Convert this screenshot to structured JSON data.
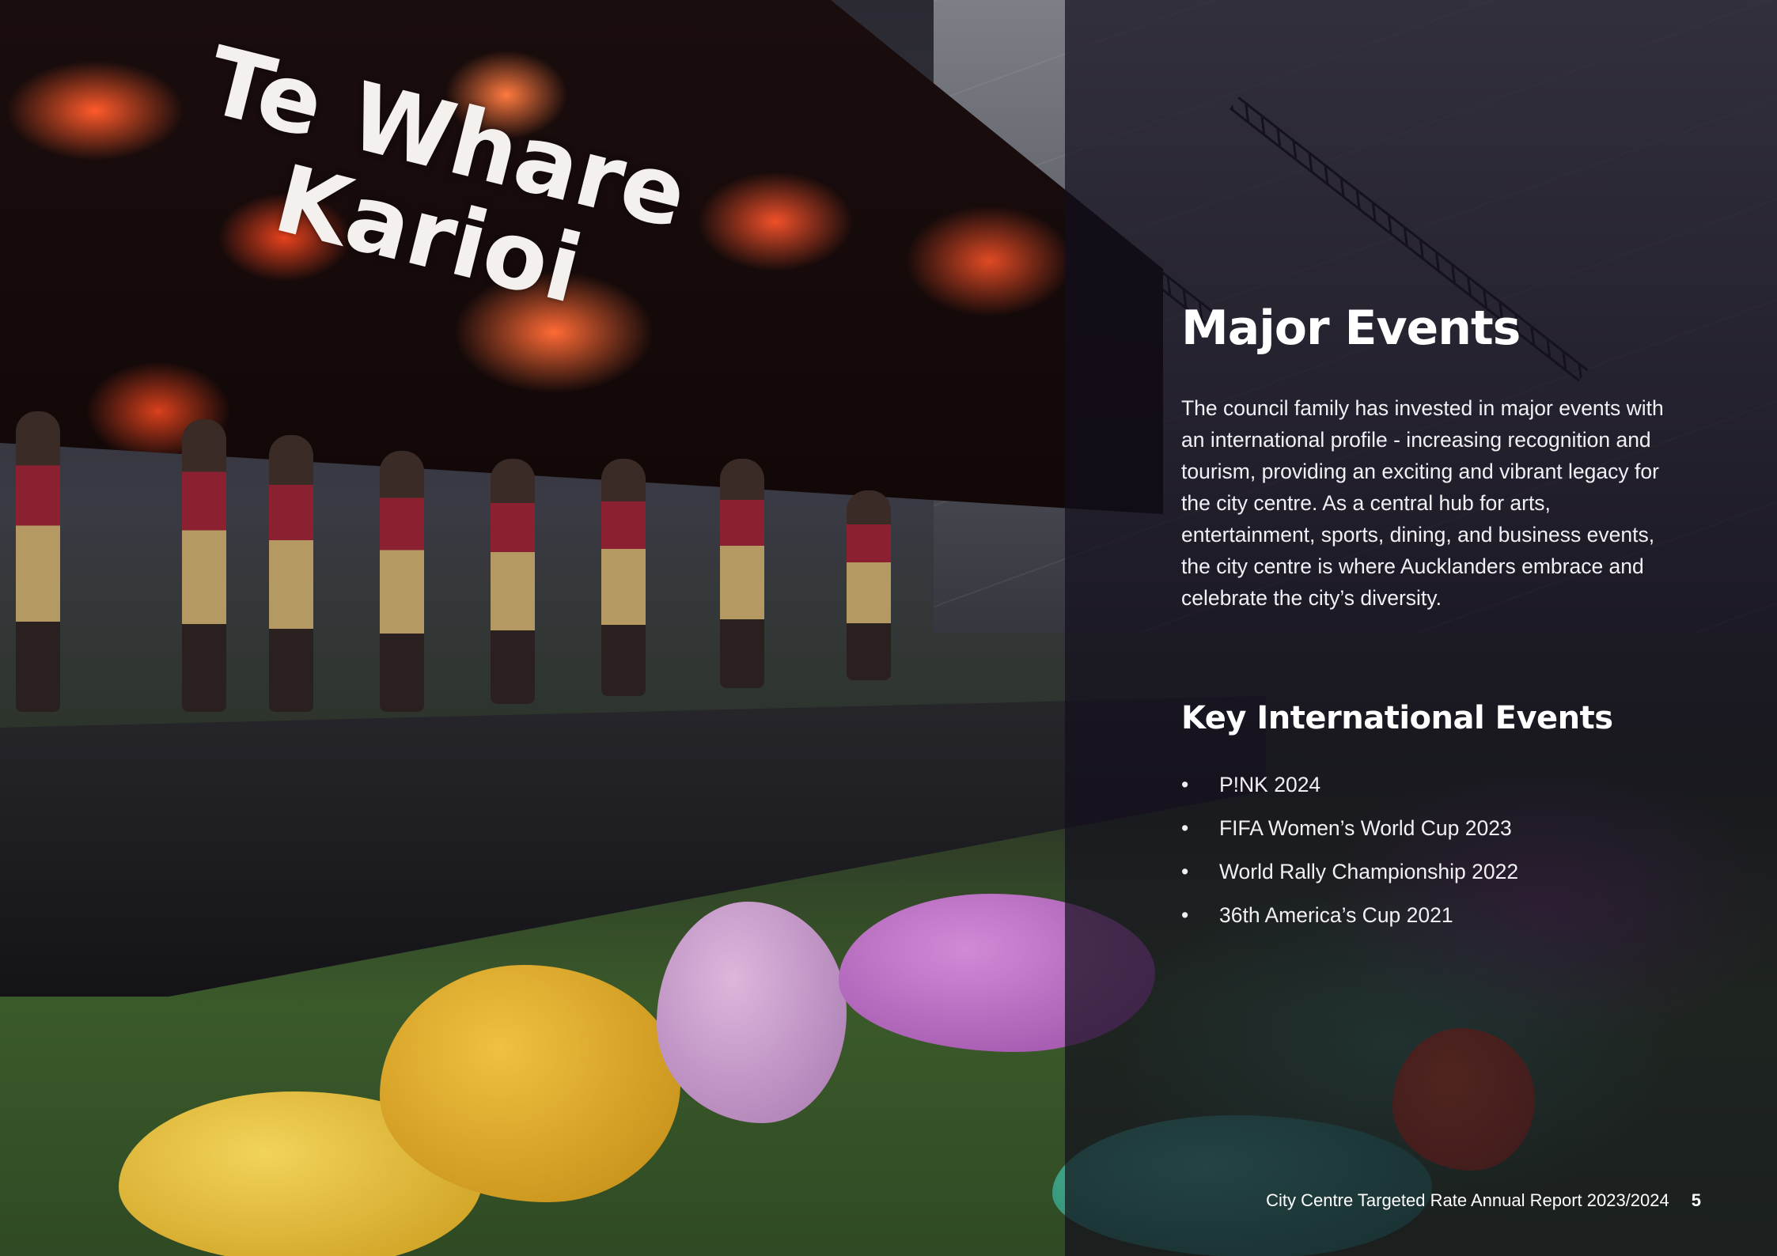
{
  "photo": {
    "screen_text_line1": "Te Whare",
    "screen_text_line2": "Karioi"
  },
  "article": {
    "title": "Major Events",
    "intro": "The council family has invested in major events with an international profile - increasing recognition and tourism, providing an exciting and vibrant legacy for the city centre. As a central hub for arts, entertainment, sports, dining, and business events, the city centre is where Aucklanders embrace and celebrate the city’s diversity.",
    "events_heading": "Key International Events",
    "bullet": "•",
    "events": [
      "P!NK 2024",
      "FIFA Women’s World Cup 2023",
      "World Rally Championship 2022",
      "36th America’s Cup 2021"
    ]
  },
  "footer": {
    "report_title": "City Centre Targeted Rate Annual Report 2023/2024",
    "page_number": "5"
  }
}
